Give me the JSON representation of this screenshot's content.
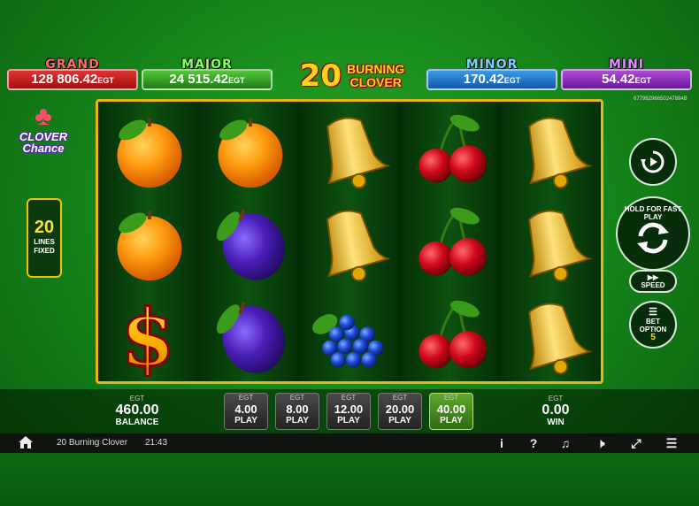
{
  "jackpots": {
    "grand": {
      "title": "GRAND",
      "value": "128 806.42",
      "currency": "EGT"
    },
    "major": {
      "title": "MAJOR",
      "value": "24 515.42",
      "currency": "EGT"
    },
    "minor": {
      "title": "MINOR",
      "value": "170.42",
      "currency": "EGT"
    },
    "mini": {
      "title": "MINI",
      "value": "54.42",
      "currency": "EGT"
    }
  },
  "game_title": {
    "number": "20",
    "line1": "BURNING",
    "line2": "CLOVER"
  },
  "game_id": "67796296650247884B",
  "logo": {
    "line1": "CLOVER",
    "line2": "Chance"
  },
  "lines": {
    "count": "20",
    "label1": "LINES",
    "label2": "FIXED"
  },
  "reels": [
    [
      "orange",
      "orange",
      "dollar"
    ],
    [
      "orange",
      "plum",
      "plum"
    ],
    [
      "bell",
      "bell",
      "grapes"
    ],
    [
      "cherry",
      "cherry",
      "cherry"
    ],
    [
      "bell",
      "bell",
      "bell"
    ]
  ],
  "controls": {
    "spin_hint": "HOLD FOR FAST PLAY",
    "speed_label": "SPEED",
    "bet_option_label": "BET OPTION",
    "bet_option_value": "5"
  },
  "balance": {
    "currency": "EGT",
    "value": "460.00",
    "label": "BALANCE"
  },
  "win": {
    "currency": "EGT",
    "value": "0.00",
    "label": "WIN"
  },
  "bets": [
    {
      "currency": "EGT",
      "amount": "4.00",
      "label": "PLAY",
      "active": false
    },
    {
      "currency": "EGT",
      "amount": "8.00",
      "label": "PLAY",
      "active": false
    },
    {
      "currency": "EGT",
      "amount": "12.00",
      "label": "PLAY",
      "active": false
    },
    {
      "currency": "EGT",
      "amount": "20.00",
      "label": "PLAY",
      "active": false
    },
    {
      "currency": "EGT",
      "amount": "40.00",
      "label": "PLAY",
      "active": true
    }
  ],
  "status_bar": {
    "game_name": "20 Burning Clover",
    "time": "21:43",
    "icons": [
      "home-icon",
      "info-icon",
      "help-icon",
      "music-off-icon",
      "sound-off-icon",
      "fullscreen-exit-icon",
      "menu-icon"
    ]
  }
}
